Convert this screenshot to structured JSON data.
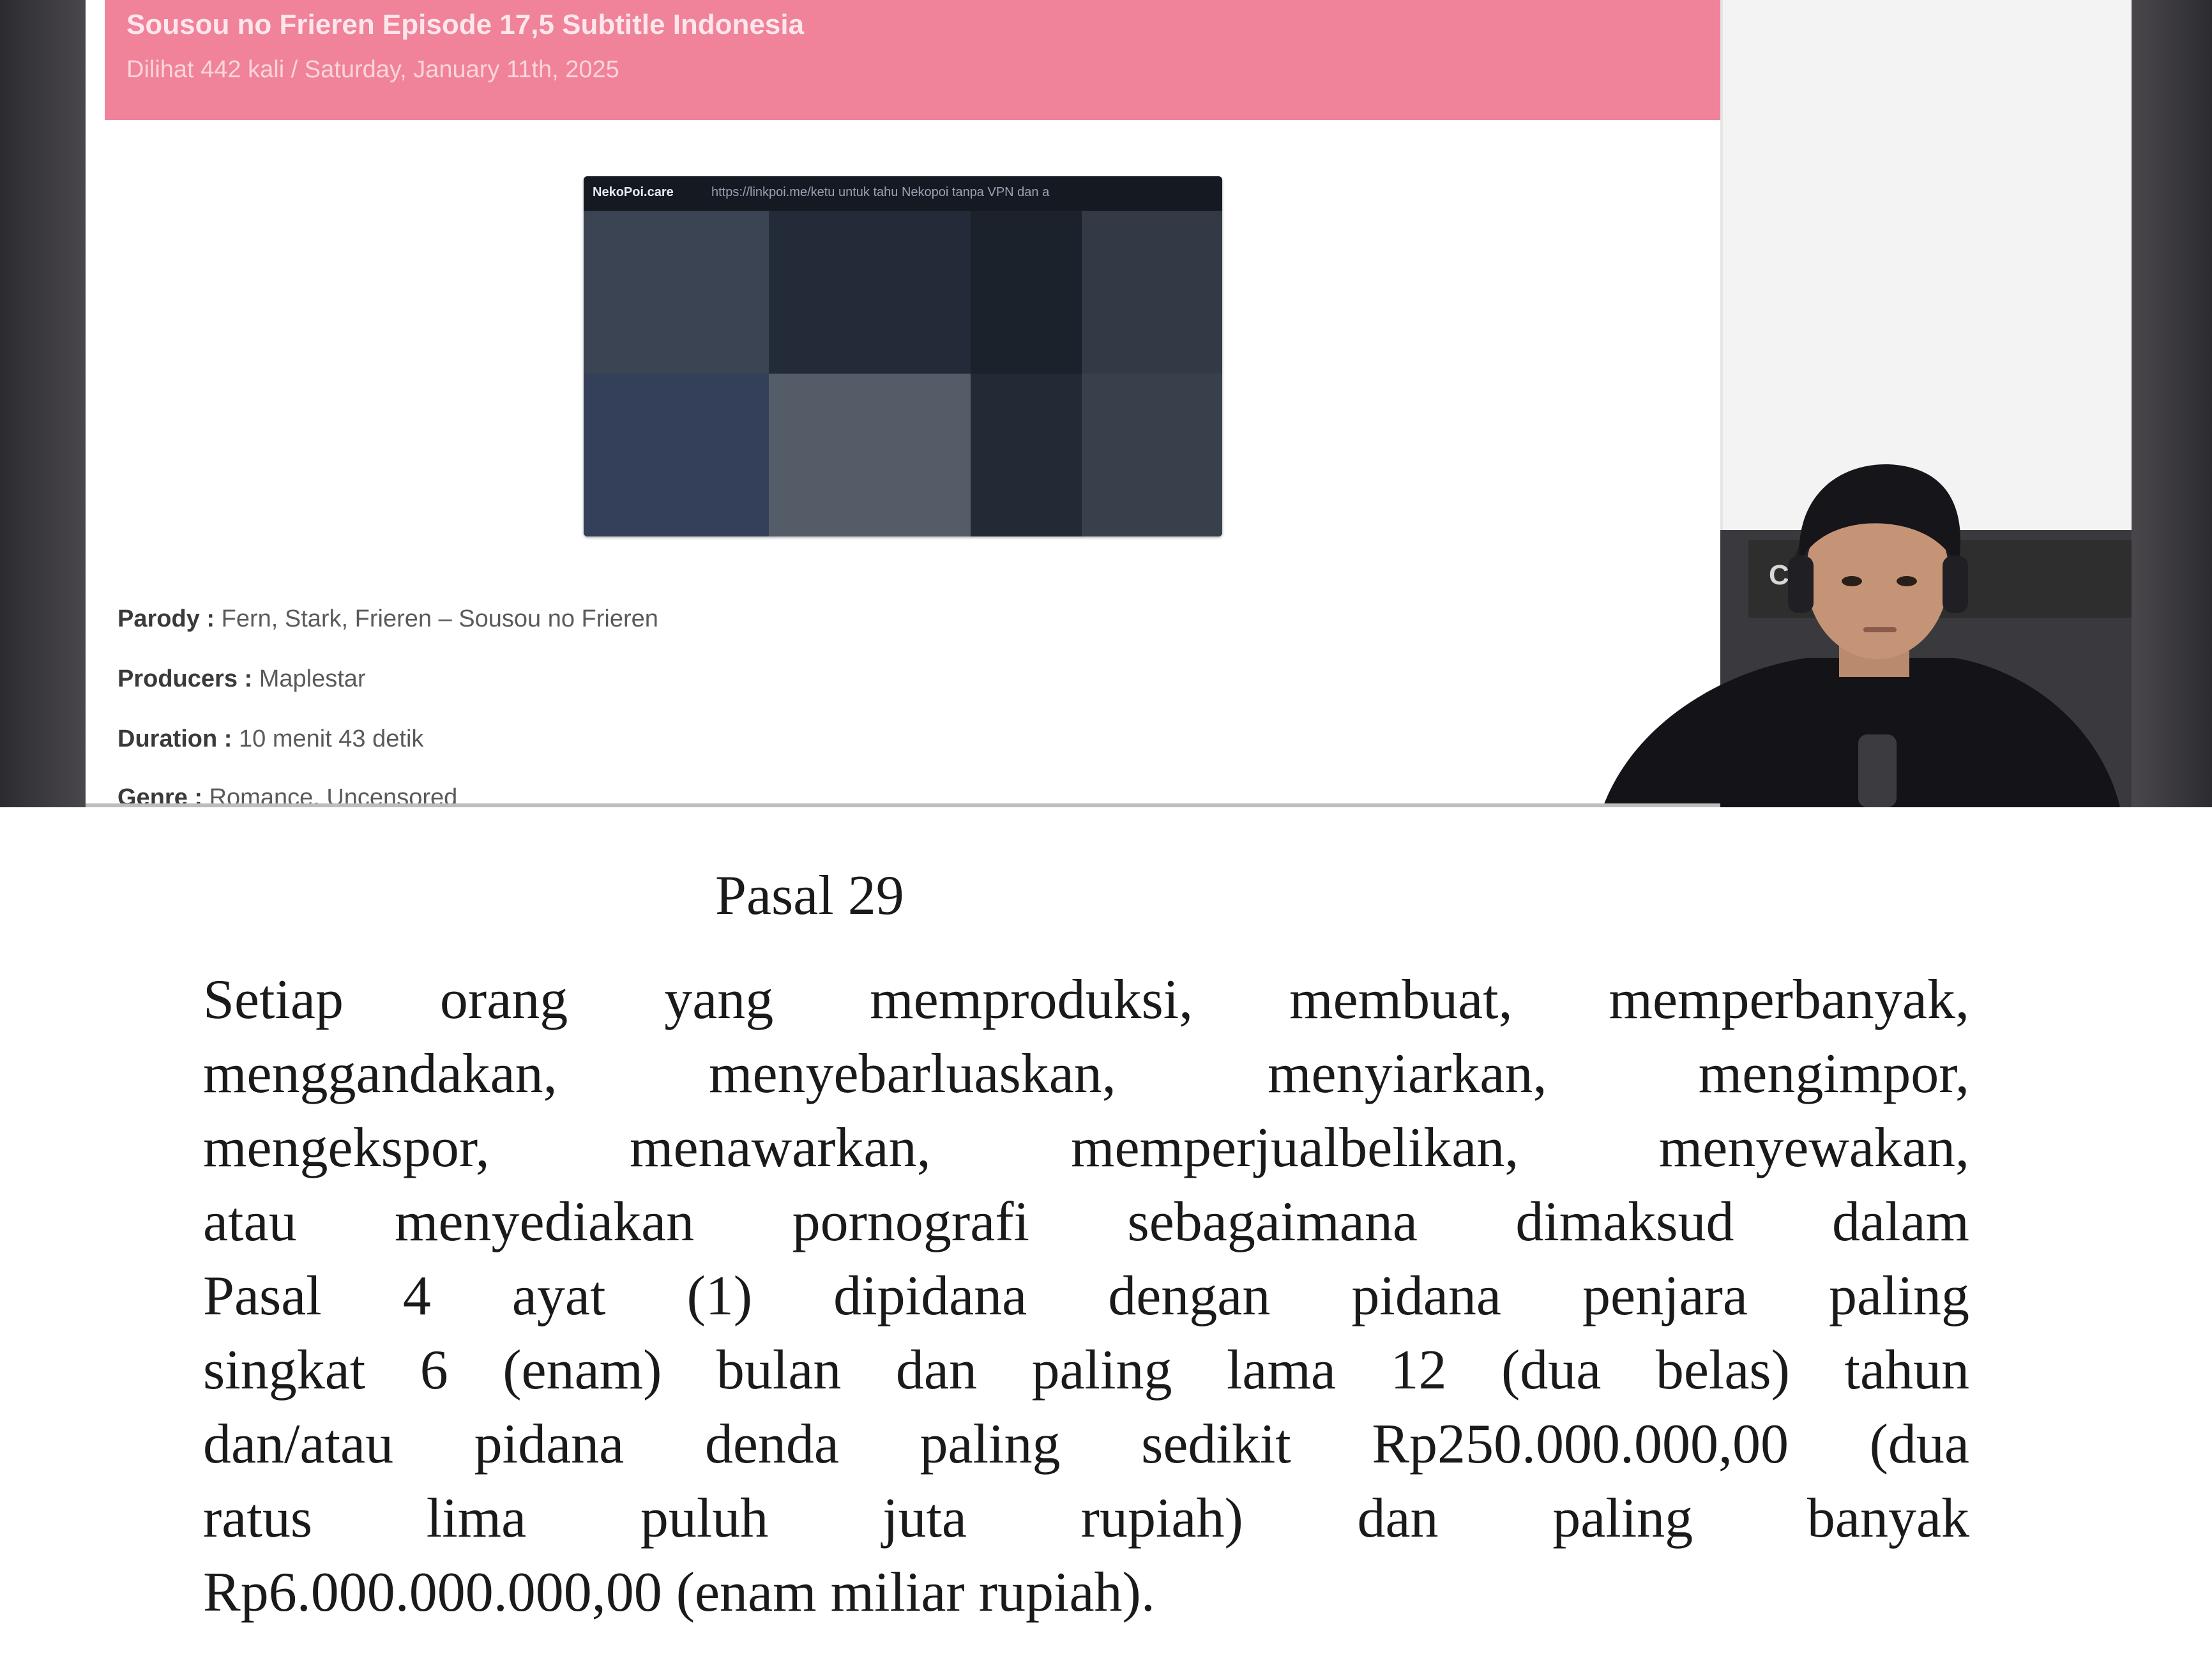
{
  "screen": {
    "post": {
      "title": "Sousou no Frieren Episode 17,5 Subtitle Indonesia",
      "meta": "Dilihat 442 kali / Saturday, January 11th, 2025"
    },
    "video": {
      "logo_text": "NekoPoi.care",
      "overlay_url": "https://linkpoi.me/ketu untuk tahu Nekopoi tanpa VPN dan a"
    },
    "info": {
      "parody": {
        "label": "Parody :",
        "value": " Fern, Stark, Frieren – Sousou no Frieren"
      },
      "producers": {
        "label": "Producers :",
        "value": " Maplestar"
      },
      "duration": {
        "label": "Duration :",
        "value": " 10 menit 43 detik"
      },
      "genre": {
        "label": "Genre :",
        "value": " Romance, Uncensored"
      }
    },
    "chat": {
      "initial": "C"
    }
  },
  "document": {
    "heading": "Pasal 29",
    "body_lines": [
      "Setiap orang yang memproduksi, membuat, memperbanyak,",
      "menggandakan, menyebarluaskan, menyiarkan, mengimpor,",
      "mengekspor, menawarkan, memperjualbelikan, menyewakan,",
      "atau menyediakan pornografi sebagaimana dimaksud dalam",
      "Pasal 4 ayat (1) dipidana  dengan pidana penjara paling",
      "singkat 6 (enam) bulan dan paling lama 12 (dua belas) tahun",
      "dan/atau pidana denda paling sedikit Rp250.000.000,00 (dua",
      "ratus lima puluh juta rupiah) dan paling banyak",
      "Rp6.000.000.000,00 (enam  miliar rupiah)."
    ]
  },
  "colors": {
    "banner": "#f08299",
    "video_bg": "#1f2530",
    "text_dark": "#1a1a1a"
  }
}
